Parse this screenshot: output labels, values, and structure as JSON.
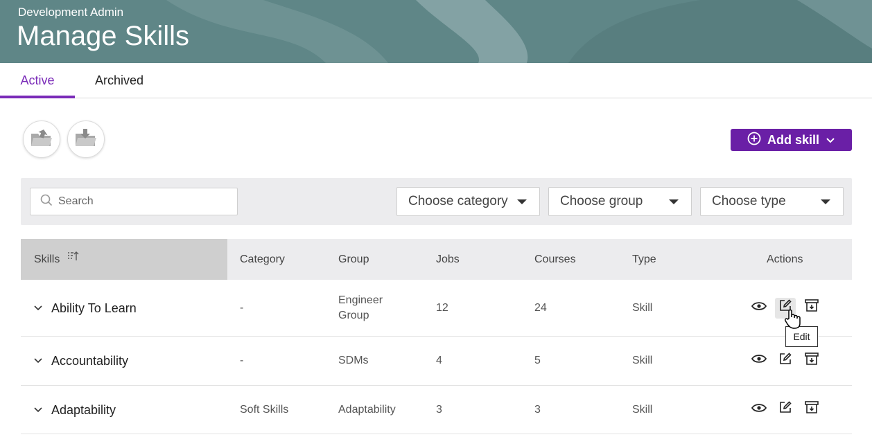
{
  "header": {
    "subtitle": "Development Admin",
    "title": "Manage Skills"
  },
  "tabs": [
    {
      "label": "Active",
      "active": true
    },
    {
      "label": "Archived",
      "active": false
    }
  ],
  "toolbar": {
    "import_icon": "folder-upload-icon",
    "export_icon": "folder-download-icon",
    "add_label": "Add skill"
  },
  "filters": {
    "search_placeholder": "Search",
    "category_placeholder": "Choose category",
    "group_placeholder": "Choose group",
    "type_placeholder": "Choose type"
  },
  "table": {
    "columns": [
      "Skills",
      "Category",
      "Group",
      "Jobs",
      "Courses",
      "Type",
      "Actions"
    ],
    "rows": [
      {
        "skill": "Ability To Learn",
        "category": "-",
        "group": "Engineer Group",
        "jobs": "12",
        "courses": "24",
        "type": "Skill"
      },
      {
        "skill": "Accountability",
        "category": "-",
        "group": "SDMs",
        "jobs": "4",
        "courses": "5",
        "type": "Skill"
      },
      {
        "skill": "Adaptability",
        "category": "Soft Skills",
        "group": "Adaptability",
        "jobs": "3",
        "courses": "3",
        "type": "Skill"
      }
    ]
  },
  "tooltip": {
    "edit": "Edit"
  },
  "colors": {
    "accent": "#6a1fa6",
    "tab_active": "#7a2bb8",
    "banner": "#5f8687"
  }
}
